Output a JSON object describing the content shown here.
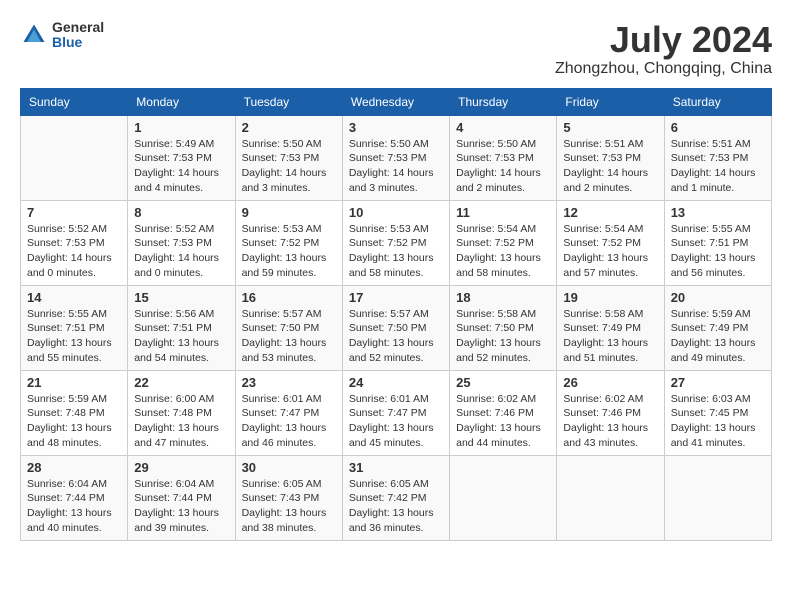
{
  "header": {
    "logo_general": "General",
    "logo_blue": "Blue",
    "month_title": "July 2024",
    "location": "Zhongzhou, Chongqing, China"
  },
  "weekdays": [
    "Sunday",
    "Monday",
    "Tuesday",
    "Wednesday",
    "Thursday",
    "Friday",
    "Saturday"
  ],
  "weeks": [
    [
      {
        "day": "",
        "info": ""
      },
      {
        "day": "1",
        "info": "Sunrise: 5:49 AM\nSunset: 7:53 PM\nDaylight: 14 hours\nand 4 minutes."
      },
      {
        "day": "2",
        "info": "Sunrise: 5:50 AM\nSunset: 7:53 PM\nDaylight: 14 hours\nand 3 minutes."
      },
      {
        "day": "3",
        "info": "Sunrise: 5:50 AM\nSunset: 7:53 PM\nDaylight: 14 hours\nand 3 minutes."
      },
      {
        "day": "4",
        "info": "Sunrise: 5:50 AM\nSunset: 7:53 PM\nDaylight: 14 hours\nand 2 minutes."
      },
      {
        "day": "5",
        "info": "Sunrise: 5:51 AM\nSunset: 7:53 PM\nDaylight: 14 hours\nand 2 minutes."
      },
      {
        "day": "6",
        "info": "Sunrise: 5:51 AM\nSunset: 7:53 PM\nDaylight: 14 hours\nand 1 minute."
      }
    ],
    [
      {
        "day": "7",
        "info": "Sunrise: 5:52 AM\nSunset: 7:53 PM\nDaylight: 14 hours\nand 0 minutes."
      },
      {
        "day": "8",
        "info": "Sunrise: 5:52 AM\nSunset: 7:53 PM\nDaylight: 14 hours\nand 0 minutes."
      },
      {
        "day": "9",
        "info": "Sunrise: 5:53 AM\nSunset: 7:52 PM\nDaylight: 13 hours\nand 59 minutes."
      },
      {
        "day": "10",
        "info": "Sunrise: 5:53 AM\nSunset: 7:52 PM\nDaylight: 13 hours\nand 58 minutes."
      },
      {
        "day": "11",
        "info": "Sunrise: 5:54 AM\nSunset: 7:52 PM\nDaylight: 13 hours\nand 58 minutes."
      },
      {
        "day": "12",
        "info": "Sunrise: 5:54 AM\nSunset: 7:52 PM\nDaylight: 13 hours\nand 57 minutes."
      },
      {
        "day": "13",
        "info": "Sunrise: 5:55 AM\nSunset: 7:51 PM\nDaylight: 13 hours\nand 56 minutes."
      }
    ],
    [
      {
        "day": "14",
        "info": "Sunrise: 5:55 AM\nSunset: 7:51 PM\nDaylight: 13 hours\nand 55 minutes."
      },
      {
        "day": "15",
        "info": "Sunrise: 5:56 AM\nSunset: 7:51 PM\nDaylight: 13 hours\nand 54 minutes."
      },
      {
        "day": "16",
        "info": "Sunrise: 5:57 AM\nSunset: 7:50 PM\nDaylight: 13 hours\nand 53 minutes."
      },
      {
        "day": "17",
        "info": "Sunrise: 5:57 AM\nSunset: 7:50 PM\nDaylight: 13 hours\nand 52 minutes."
      },
      {
        "day": "18",
        "info": "Sunrise: 5:58 AM\nSunset: 7:50 PM\nDaylight: 13 hours\nand 52 minutes."
      },
      {
        "day": "19",
        "info": "Sunrise: 5:58 AM\nSunset: 7:49 PM\nDaylight: 13 hours\nand 51 minutes."
      },
      {
        "day": "20",
        "info": "Sunrise: 5:59 AM\nSunset: 7:49 PM\nDaylight: 13 hours\nand 49 minutes."
      }
    ],
    [
      {
        "day": "21",
        "info": "Sunrise: 5:59 AM\nSunset: 7:48 PM\nDaylight: 13 hours\nand 48 minutes."
      },
      {
        "day": "22",
        "info": "Sunrise: 6:00 AM\nSunset: 7:48 PM\nDaylight: 13 hours\nand 47 minutes."
      },
      {
        "day": "23",
        "info": "Sunrise: 6:01 AM\nSunset: 7:47 PM\nDaylight: 13 hours\nand 46 minutes."
      },
      {
        "day": "24",
        "info": "Sunrise: 6:01 AM\nSunset: 7:47 PM\nDaylight: 13 hours\nand 45 minutes."
      },
      {
        "day": "25",
        "info": "Sunrise: 6:02 AM\nSunset: 7:46 PM\nDaylight: 13 hours\nand 44 minutes."
      },
      {
        "day": "26",
        "info": "Sunrise: 6:02 AM\nSunset: 7:46 PM\nDaylight: 13 hours\nand 43 minutes."
      },
      {
        "day": "27",
        "info": "Sunrise: 6:03 AM\nSunset: 7:45 PM\nDaylight: 13 hours\nand 41 minutes."
      }
    ],
    [
      {
        "day": "28",
        "info": "Sunrise: 6:04 AM\nSunset: 7:44 PM\nDaylight: 13 hours\nand 40 minutes."
      },
      {
        "day": "29",
        "info": "Sunrise: 6:04 AM\nSunset: 7:44 PM\nDaylight: 13 hours\nand 39 minutes."
      },
      {
        "day": "30",
        "info": "Sunrise: 6:05 AM\nSunset: 7:43 PM\nDaylight: 13 hours\nand 38 minutes."
      },
      {
        "day": "31",
        "info": "Sunrise: 6:05 AM\nSunset: 7:42 PM\nDaylight: 13 hours\nand 36 minutes."
      },
      {
        "day": "",
        "info": ""
      },
      {
        "day": "",
        "info": ""
      },
      {
        "day": "",
        "info": ""
      }
    ]
  ]
}
